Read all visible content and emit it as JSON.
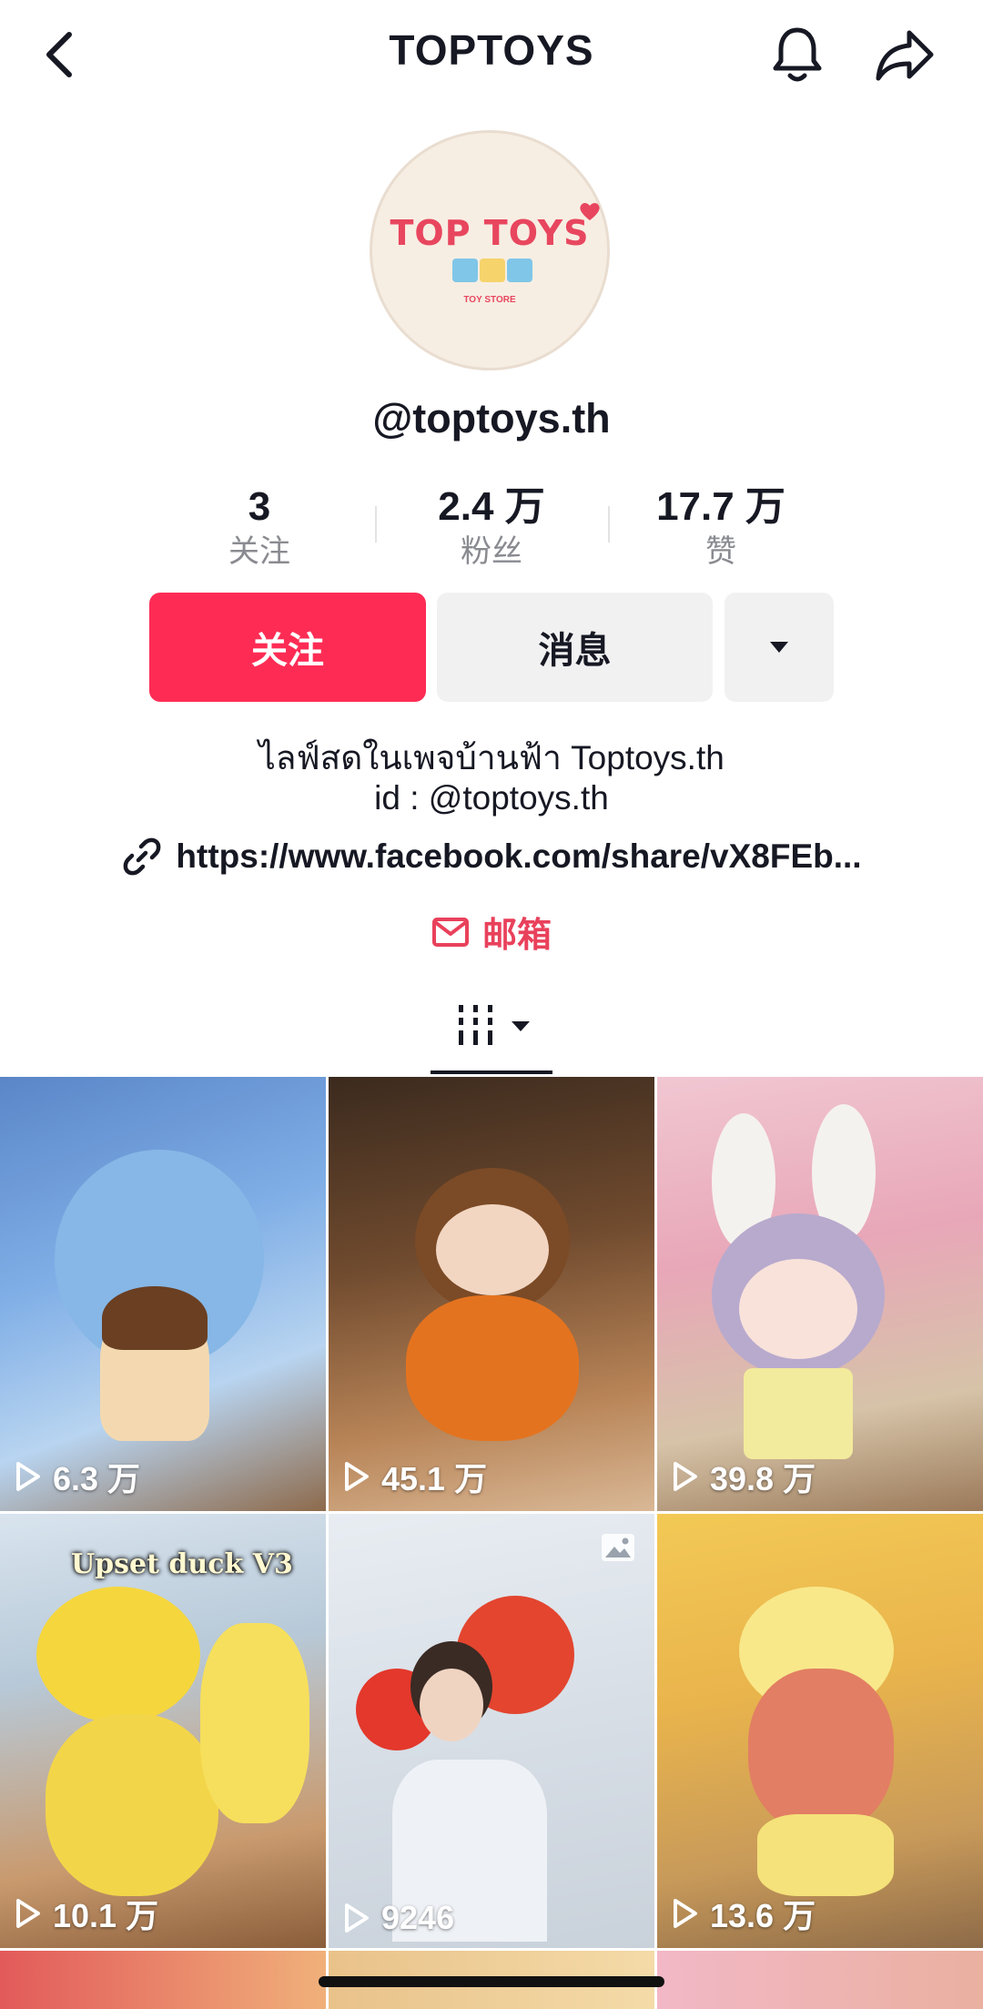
{
  "header": {
    "title": "TOPTOYS",
    "back_icon": "chevron-left-icon",
    "bell_icon": "bell-icon",
    "share_icon": "share-arrow-icon"
  },
  "profile": {
    "avatar_logo_text": "TOP TOYS",
    "avatar_logo_subtext": "TOY STORE",
    "handle": "@toptoys.th",
    "stats": [
      {
        "value": "3",
        "label": "关注"
      },
      {
        "value": "2.4 万",
        "label": "粉丝"
      },
      {
        "value": "17.7 万",
        "label": "赞"
      }
    ],
    "buttons": {
      "follow": "关注",
      "message": "消息",
      "more_icon": "caret-down-icon"
    },
    "bio_line1": "ไลฟ์สดในเพจบ้านฟ้า Toptoys.th",
    "bio_line2": "id : @toptoys.th",
    "link": "https://www.facebook.com/share/vX8FEb...",
    "email_label": "邮箱"
  },
  "tabs": {
    "grid_icon": "grid-columns-icon",
    "dropdown_icon": "caret-down-icon"
  },
  "videos": [
    {
      "views": "6.3 万"
    },
    {
      "views": "45.1 万"
    },
    {
      "views": "39.8 万"
    },
    {
      "views": "10.1 万",
      "caption": "Upset duck V3"
    },
    {
      "views": "9246",
      "badge": "photo-icon"
    },
    {
      "views": "13.6 万"
    }
  ],
  "colors": {
    "accent": "#FE2C55",
    "email": "#E9415B",
    "secondary_button": "#F1F1F2"
  }
}
